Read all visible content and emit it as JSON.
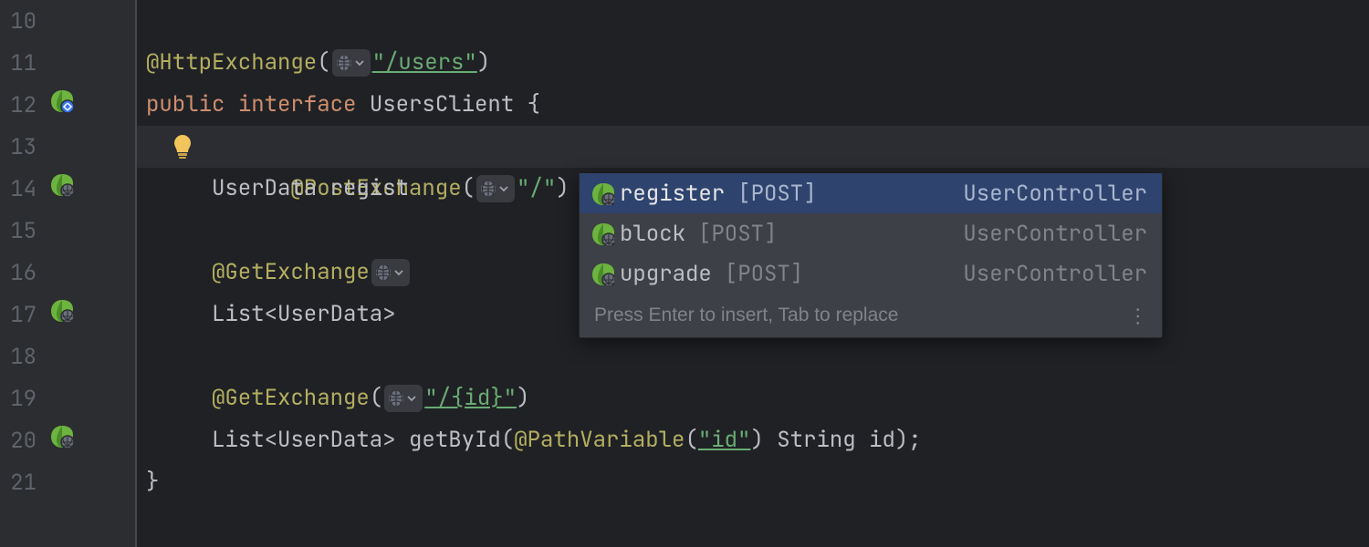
{
  "lines": {
    "10": "10",
    "11": "11",
    "12": "12",
    "13": "13",
    "14": "14",
    "15": "15",
    "16": "16",
    "17": "17",
    "18": "18",
    "19": "19",
    "20": "20",
    "21": "21"
  },
  "code": {
    "ann_http": "@HttpExchange",
    "lp": "(",
    "rp": ")",
    "slash_users": "\"/users\"",
    "kw_public": "public",
    "kw_interface": "interface",
    "type_users_client": "UsersClient",
    "lbrace": "{",
    "rbrace": "}",
    "ann_post": "@PostExchange",
    "str_slash": "\"/\"",
    "type_userdata": "UserData",
    "txt_regist": "regist",
    "ann_get": "@GetExchange",
    "type_list_userdata": "List<UserData>",
    "ann_get2": "@GetExchange",
    "str_id": "\"/{id}\"",
    "mname_getbyid": "getById",
    "ann_pathvar": "@PathVariable",
    "str_id2": "\"id\"",
    "type_string": "String",
    "param_id": "id",
    "semi_end": ";"
  },
  "popup": {
    "items": [
      {
        "name": "register",
        "verb": "[POST]",
        "tail": "UserController"
      },
      {
        "name": "block",
        "verb": "[POST]",
        "tail": "UserController"
      },
      {
        "name": "upgrade",
        "verb": "[POST]",
        "tail": "UserController"
      }
    ],
    "footer": "Press Enter to insert, Tab to replace"
  }
}
